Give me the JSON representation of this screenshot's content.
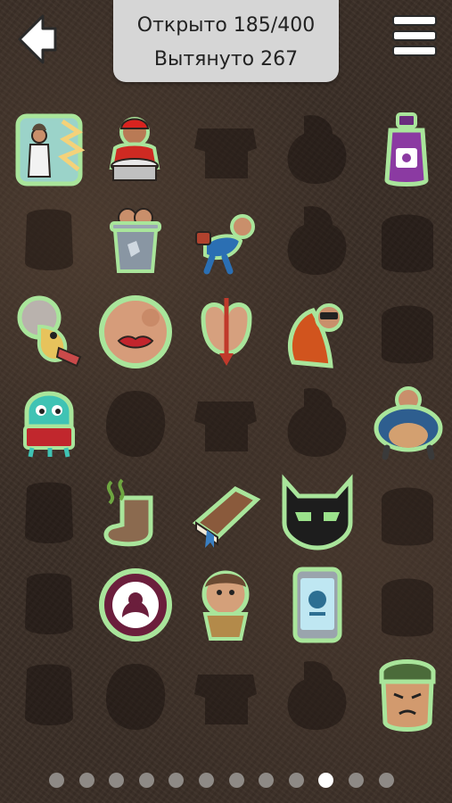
{
  "header": {
    "opened_text": "Открыто 185/400",
    "pulled_text": "Вытянуто 267"
  },
  "icons": {
    "back": "back-arrow-icon",
    "menu": "hamburger-menu-icon"
  },
  "collection": [
    {
      "row": 0,
      "col": 0,
      "unlocked": true,
      "item": "praying-man-card"
    },
    {
      "row": 0,
      "col": 1,
      "unlocked": true,
      "item": "drummer"
    },
    {
      "row": 0,
      "col": 2,
      "unlocked": false
    },
    {
      "row": 0,
      "col": 3,
      "unlocked": false
    },
    {
      "row": 0,
      "col": 4,
      "unlocked": true,
      "item": "purple-bottle"
    },
    {
      "row": 1,
      "col": 0,
      "unlocked": false
    },
    {
      "row": 1,
      "col": 1,
      "unlocked": true,
      "item": "trash-can-man"
    },
    {
      "row": 1,
      "col": 2,
      "unlocked": true,
      "item": "flying-man"
    },
    {
      "row": 1,
      "col": 3,
      "unlocked": false
    },
    {
      "row": 1,
      "col": 4,
      "unlocked": false
    },
    {
      "row": 2,
      "col": 0,
      "unlocked": true,
      "item": "old-lady"
    },
    {
      "row": 2,
      "col": 1,
      "unlocked": true,
      "item": "lips-face"
    },
    {
      "row": 2,
      "col": 2,
      "unlocked": true,
      "item": "butt-arrow"
    },
    {
      "row": 2,
      "col": 3,
      "unlocked": true,
      "item": "red-hair-man"
    },
    {
      "row": 2,
      "col": 4,
      "unlocked": false
    },
    {
      "row": 3,
      "col": 0,
      "unlocked": true,
      "item": "squid-drinker"
    },
    {
      "row": 3,
      "col": 1,
      "unlocked": false
    },
    {
      "row": 3,
      "col": 2,
      "unlocked": false
    },
    {
      "row": 3,
      "col": 3,
      "unlocked": false
    },
    {
      "row": 3,
      "col": 4,
      "unlocked": true,
      "item": "fat-man"
    },
    {
      "row": 4,
      "col": 0,
      "unlocked": false
    },
    {
      "row": 4,
      "col": 1,
      "unlocked": true,
      "item": "smelly-sock"
    },
    {
      "row": 4,
      "col": 2,
      "unlocked": true,
      "item": "book"
    },
    {
      "row": 4,
      "col": 3,
      "unlocked": true,
      "item": "bat-mask"
    },
    {
      "row": 4,
      "col": 4,
      "unlocked": false
    },
    {
      "row": 5,
      "col": 0,
      "unlocked": false
    },
    {
      "row": 5,
      "col": 1,
      "unlocked": true,
      "item": "round-badge"
    },
    {
      "row": 5,
      "col": 2,
      "unlocked": true,
      "item": "cupcake-man"
    },
    {
      "row": 5,
      "col": 3,
      "unlocked": true,
      "item": "phone"
    },
    {
      "row": 5,
      "col": 4,
      "unlocked": false
    },
    {
      "row": 6,
      "col": 0,
      "unlocked": false
    },
    {
      "row": 6,
      "col": 1,
      "unlocked": false
    },
    {
      "row": 6,
      "col": 2,
      "unlocked": false
    },
    {
      "row": 6,
      "col": 3,
      "unlocked": false
    },
    {
      "row": 6,
      "col": 4,
      "unlocked": true,
      "item": "soldier-head"
    }
  ],
  "pagination": {
    "total": 12,
    "current": 10
  }
}
